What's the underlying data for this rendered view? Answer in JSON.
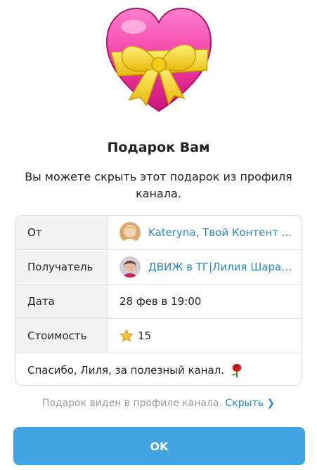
{
  "gift": {
    "title": "Подарок Вам",
    "description": "Вы можете скрыть этот подарок из профиля канала."
  },
  "details": {
    "from": {
      "label": "От",
      "value": "Kateryna, Твой Контент ..."
    },
    "recipient": {
      "label": "Получатель",
      "value": "ДВИЖ в ТГ|Лилия Шараф..."
    },
    "date": {
      "label": "Дата",
      "value": "28 фев в 19:00"
    },
    "price": {
      "label": "Стоимость",
      "value": "15"
    },
    "message": "Спасибо, Лиля, за полезный канал."
  },
  "footer": {
    "visibility_note": "Подарок виден в профиле канала.",
    "hide_link": "Скрыть ❯"
  },
  "actions": {
    "ok_label": "OK"
  },
  "colors": {
    "accent": "#2a86c8",
    "button": "#42a5e2",
    "heart": "#e8319a",
    "ribbon": "#f5d71c"
  },
  "icons": {
    "gift": "heart-with-ribbon-icon",
    "currency": "star-icon",
    "message_emoji": "rose-icon"
  }
}
